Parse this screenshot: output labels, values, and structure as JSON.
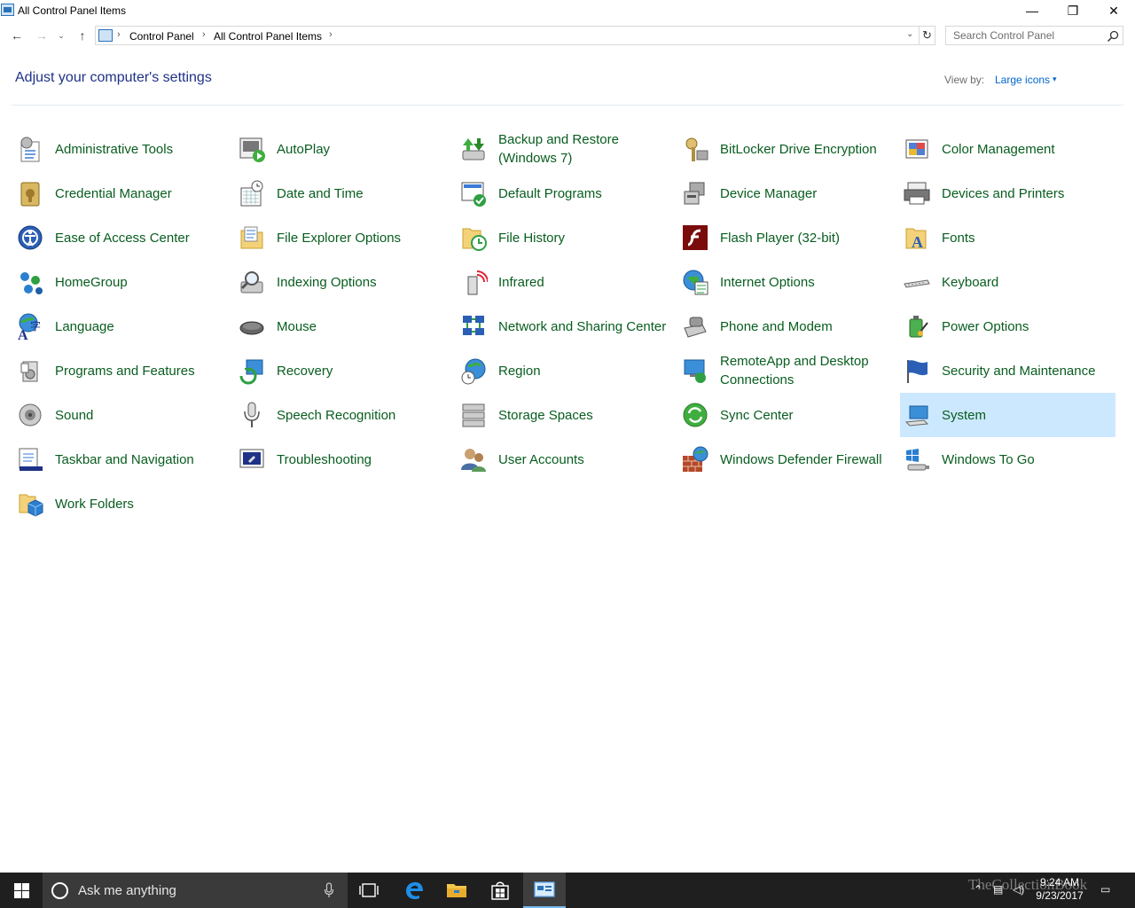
{
  "window": {
    "title": "All Control Panel Items",
    "minimize_glyph": "—",
    "maximize_glyph": "❐",
    "close_glyph": "✕"
  },
  "nav": {
    "back_glyph": "←",
    "forward_glyph": "→",
    "recent_glyph": "⌄",
    "up_glyph": "↑",
    "refresh_glyph": "↻",
    "dropdown_glyph": "⌄",
    "breadcrumbs": [
      "Control Panel",
      "All Control Panel Items"
    ],
    "separator": "›",
    "search_placeholder": "Search Control Panel"
  },
  "header": {
    "title": "Adjust your computer's settings",
    "view_by_label": "View by:",
    "view_by_value": "Large icons",
    "view_by_arrow": "▾"
  },
  "items": [
    [
      "Administrative Tools",
      "AutoPlay",
      "Backup and Restore (Windows 7)",
      "BitLocker Drive Encryption",
      "Color Management"
    ],
    [
      "Credential Manager",
      "Date and Time",
      "Default Programs",
      "Device Manager",
      "Devices and Printers"
    ],
    [
      "Ease of Access Center",
      "File Explorer Options",
      "File History",
      "Flash Player (32-bit)",
      "Fonts"
    ],
    [
      "HomeGroup",
      "Indexing Options",
      "Infrared",
      "Internet Options",
      "Keyboard"
    ],
    [
      "Language",
      "Mouse",
      "Network and Sharing Center",
      "Phone and Modem",
      "Power Options"
    ],
    [
      "Programs and Features",
      "Recovery",
      "Region",
      "RemoteApp and Desktop Connections",
      "Security and Maintenance"
    ],
    [
      "Sound",
      "Speech Recognition",
      "Storage Spaces",
      "Sync Center",
      "System"
    ],
    [
      "Taskbar and Navigation",
      "Troubleshooting",
      "User Accounts",
      "Windows Defender Firewall",
      "Windows To Go"
    ],
    [
      "Work Folders"
    ]
  ],
  "selected_item": "System",
  "taskbar": {
    "search_text": "Ask me anything",
    "time": "9:24 AM",
    "date": "9/23/2017",
    "watermark": "TheCollectionBook"
  },
  "colors": {
    "link_green": "#085d1f",
    "header_blue": "#1e3287",
    "selection": "#cce8ff",
    "taskbar": "#1f1f1f"
  }
}
